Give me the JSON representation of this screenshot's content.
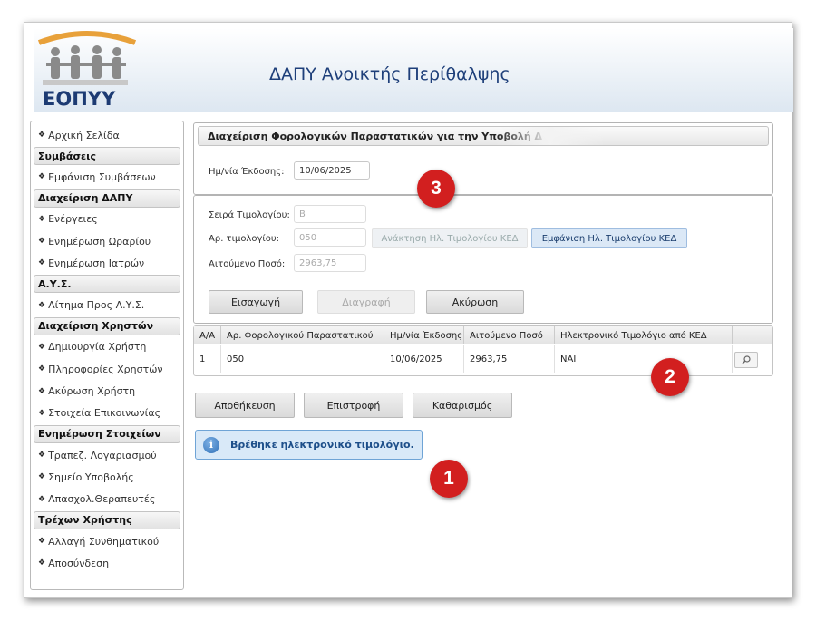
{
  "header": {
    "title": "ΔΑΠΥ Ανοικτής Περίθαλψης",
    "logo_text": "ΕΟΠΥΥ"
  },
  "sidebar": {
    "items": [
      {
        "type": "link",
        "label": "Αρχική Σελίδα"
      },
      {
        "type": "header",
        "label": "Συμβάσεις"
      },
      {
        "type": "link",
        "label": "Εμφάνιση Συμβάσεων"
      },
      {
        "type": "header",
        "label": "Διαχείριση ΔΑΠΥ"
      },
      {
        "type": "link",
        "label": "Ενέργειες"
      },
      {
        "type": "link",
        "label": "Ενημέρωση Ωραρίου"
      },
      {
        "type": "link",
        "label": "Ενημέρωση Ιατρών"
      },
      {
        "type": "header",
        "label": "Α.Υ.Σ."
      },
      {
        "type": "link",
        "label": "Αίτημα Προς Α.Υ.Σ."
      },
      {
        "type": "header",
        "label": "Διαχείριση Χρηστών"
      },
      {
        "type": "link",
        "label": "Δημιουργία Χρήστη"
      },
      {
        "type": "link",
        "label": "Πληροφορίες Χρηστών"
      },
      {
        "type": "link",
        "label": "Ακύρωση Χρήστη"
      },
      {
        "type": "link",
        "label": "Στοιχεία Επικοινωνίας"
      },
      {
        "type": "header",
        "label": "Ενημέρωση Στοιχείων"
      },
      {
        "type": "link",
        "label": "Τραπεζ. Λογαριασμού"
      },
      {
        "type": "link",
        "label": "Σημείο Υποβολής"
      },
      {
        "type": "link",
        "label": "Απασχολ.Θεραπευτές"
      },
      {
        "type": "header",
        "label": "Τρέχων Χρήστης"
      },
      {
        "type": "link",
        "label": "Αλλαγή Συνθηματικού"
      },
      {
        "type": "link",
        "label": "Αποσύνδεση"
      }
    ]
  },
  "panel": {
    "title": "Διαχείριση Φορολογικών Παραστατικών για την Υποβολή Δ",
    "issue_date_label": "Ημ/νία Έκδοσης:",
    "issue_date_value": "10/06/2025"
  },
  "invoice": {
    "series_label": "Σειρά Τιμολογίου:",
    "series_value": "Β",
    "number_label": "Αρ. τιμολογίου:",
    "number_value": "050",
    "amount_label": "Αιτούμενο Ποσό:",
    "amount_value": "2963,75",
    "retrieve_button": "Ανάκτηση Ηλ. Τιμολογίου ΚΕΔ",
    "show_button": "Εμφάνιση Ηλ. Τιμολογίου ΚΕΔ",
    "insert_button": "Εισαγωγή",
    "delete_button": "Διαγραφή",
    "cancel_button": "Ακύρωση"
  },
  "table": {
    "headers": [
      "Α/Α",
      "Αρ. Φορολογικού Παραστατικού",
      "Ημ/νία Έκδοσης",
      "Αιτούμενο Ποσό",
      "Ηλεκτρονικό Τιμολόγιο από ΚΕΔ"
    ],
    "rows": [
      [
        "1",
        "050",
        "10/06/2025",
        "2963,75",
        "ΝΑΙ"
      ]
    ]
  },
  "actions": {
    "save": "Αποθήκευση",
    "back": "Επιστροφή",
    "clear": "Καθαρισμός"
  },
  "message": "Βρέθηκε ηλεκτρονικό τιμολόγιο.",
  "badges": [
    "1",
    "2",
    "3"
  ],
  "colors": {
    "accent": "#1e3f7a",
    "badge": "#d21f1f",
    "info_bg": "#d9e9f8"
  }
}
